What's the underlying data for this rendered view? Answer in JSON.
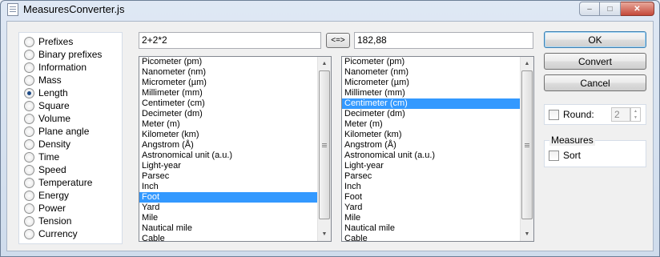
{
  "window": {
    "title": "MeasuresConverter.js",
    "minimize_label": "–",
    "maximize_label": "□",
    "close_label": "✕"
  },
  "categories": [
    {
      "label": "Prefixes",
      "checked": false
    },
    {
      "label": "Binary prefixes",
      "checked": false
    },
    {
      "label": "Information",
      "checked": false
    },
    {
      "label": "Mass",
      "checked": false
    },
    {
      "label": "Length",
      "checked": true
    },
    {
      "label": "Square",
      "checked": false
    },
    {
      "label": "Volume",
      "checked": false
    },
    {
      "label": "Plane angle",
      "checked": false
    },
    {
      "label": "Density",
      "checked": false
    },
    {
      "label": "Time",
      "checked": false
    },
    {
      "label": "Speed",
      "checked": false
    },
    {
      "label": "Temperature",
      "checked": false
    },
    {
      "label": "Energy",
      "checked": false
    },
    {
      "label": "Power",
      "checked": false
    },
    {
      "label": "Tension",
      "checked": false
    },
    {
      "label": "Currency",
      "checked": false
    }
  ],
  "input": {
    "value": "2+2*2"
  },
  "swap_button": {
    "label": "<=>"
  },
  "output": {
    "value": "182,88"
  },
  "units": [
    "Picometer (pm)",
    "Nanometer (nm)",
    "Micrometer (µm)",
    "Millimeter (mm)",
    "Centimeter (cm)",
    "Decimeter (dm)",
    "Meter (m)",
    "Kilometer (km)",
    "Angstrom (Å)",
    "Astronomical unit (a.u.)",
    "Light-year",
    "Parsec",
    "Inch",
    "Foot",
    "Yard",
    "Mile",
    "Nautical mile",
    "Cable"
  ],
  "from_list": {
    "selected": "Foot"
  },
  "to_list": {
    "selected": "Centimeter (cm)"
  },
  "buttons": {
    "ok": "OK",
    "convert": "Convert",
    "cancel": "Cancel"
  },
  "round": {
    "label": "Round:",
    "checked": false,
    "value": "2",
    "up": "▲",
    "down": "▼"
  },
  "measures": {
    "group_label": "Measures",
    "sort_label": "Sort",
    "sort_checked": false
  },
  "scrollbar": {
    "up": "▲",
    "down": "▼"
  }
}
